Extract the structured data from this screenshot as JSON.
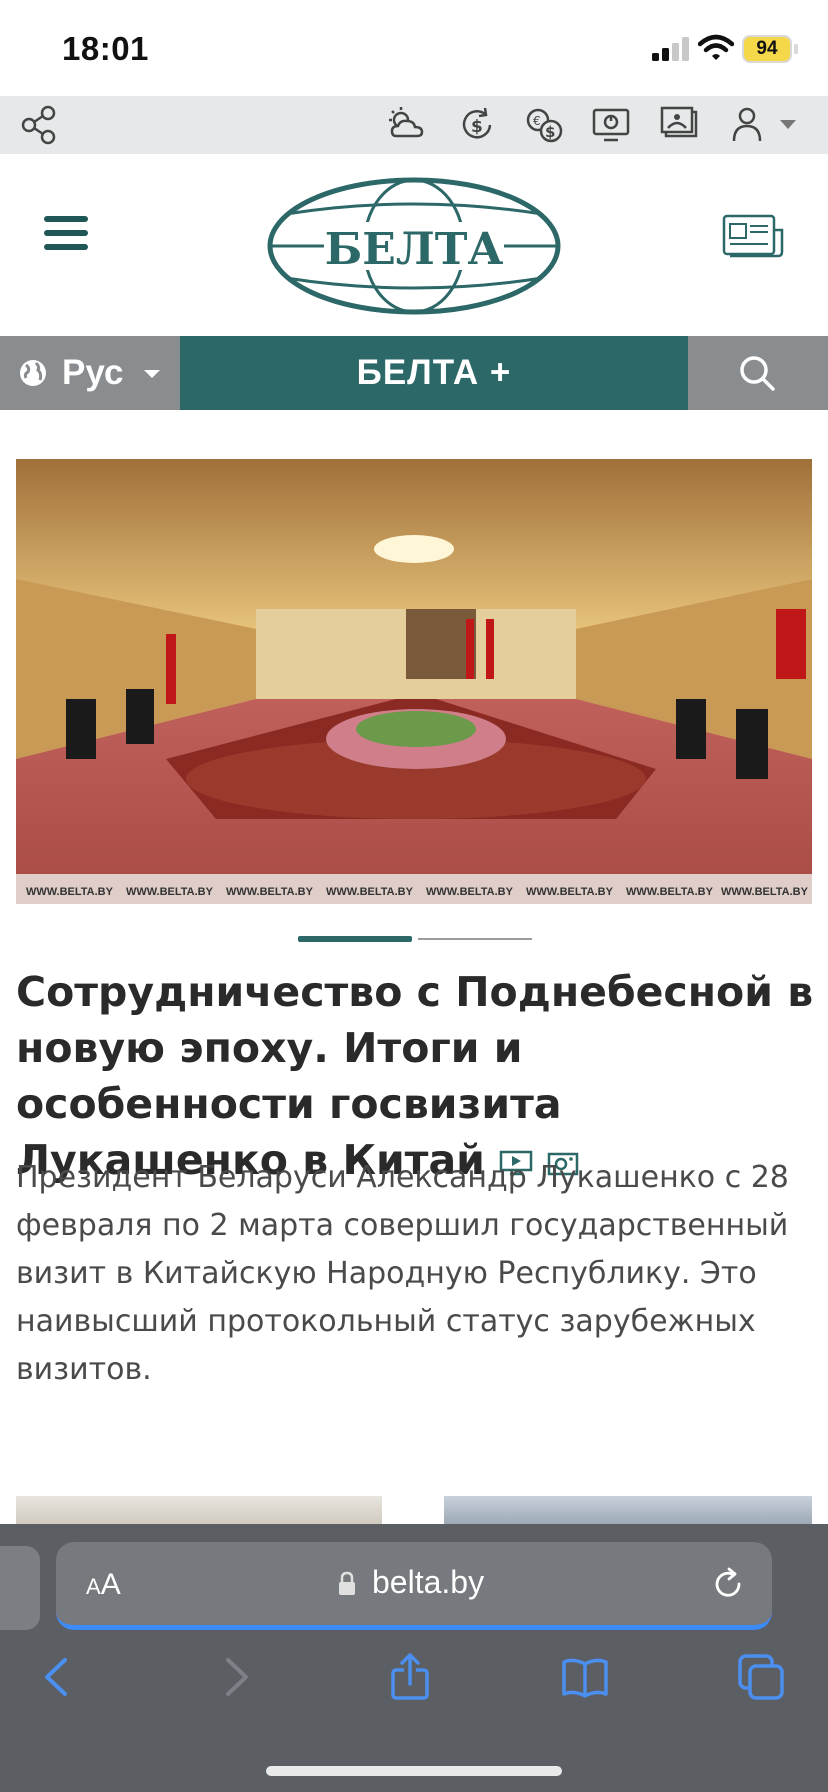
{
  "status_bar": {
    "time": "18:01",
    "battery": "94"
  },
  "toolbar": {
    "icons": [
      "share-icon",
      "weather-icon",
      "currency-icon",
      "exchange-icon",
      "tv-icon",
      "photo-icon",
      "user-icon"
    ]
  },
  "header": {
    "logo_text": "БЕЛТА"
  },
  "nav": {
    "language": "Рус",
    "plus_label": "БЕЛТА +"
  },
  "hero": {
    "watermark": "WWW.BELTA.BY",
    "carousel": {
      "active_slide": 1,
      "total_slides": 2
    }
  },
  "article": {
    "headline": "Сотрудничество с Поднебесной в новую эпоху. Итоги и особенности госвизита Лукашенко в Китай",
    "lead": "Президент Беларуси Александр Лукашенко с 28 февраля по 2 марта совершил государственный визит в Китайскую Народную Республику. Это наивысший протокольный статус зарубежных визитов."
  },
  "browser": {
    "text_size_small": "A",
    "text_size_large": "A",
    "url": "belta.by"
  },
  "colors": {
    "brand_teal": "#2c6867",
    "nav_gray": "#8a8d90",
    "toolbar_bg": "#e6e9ea",
    "safari_bg": "#5b5e63",
    "safari_accent": "#3d8bf6"
  }
}
